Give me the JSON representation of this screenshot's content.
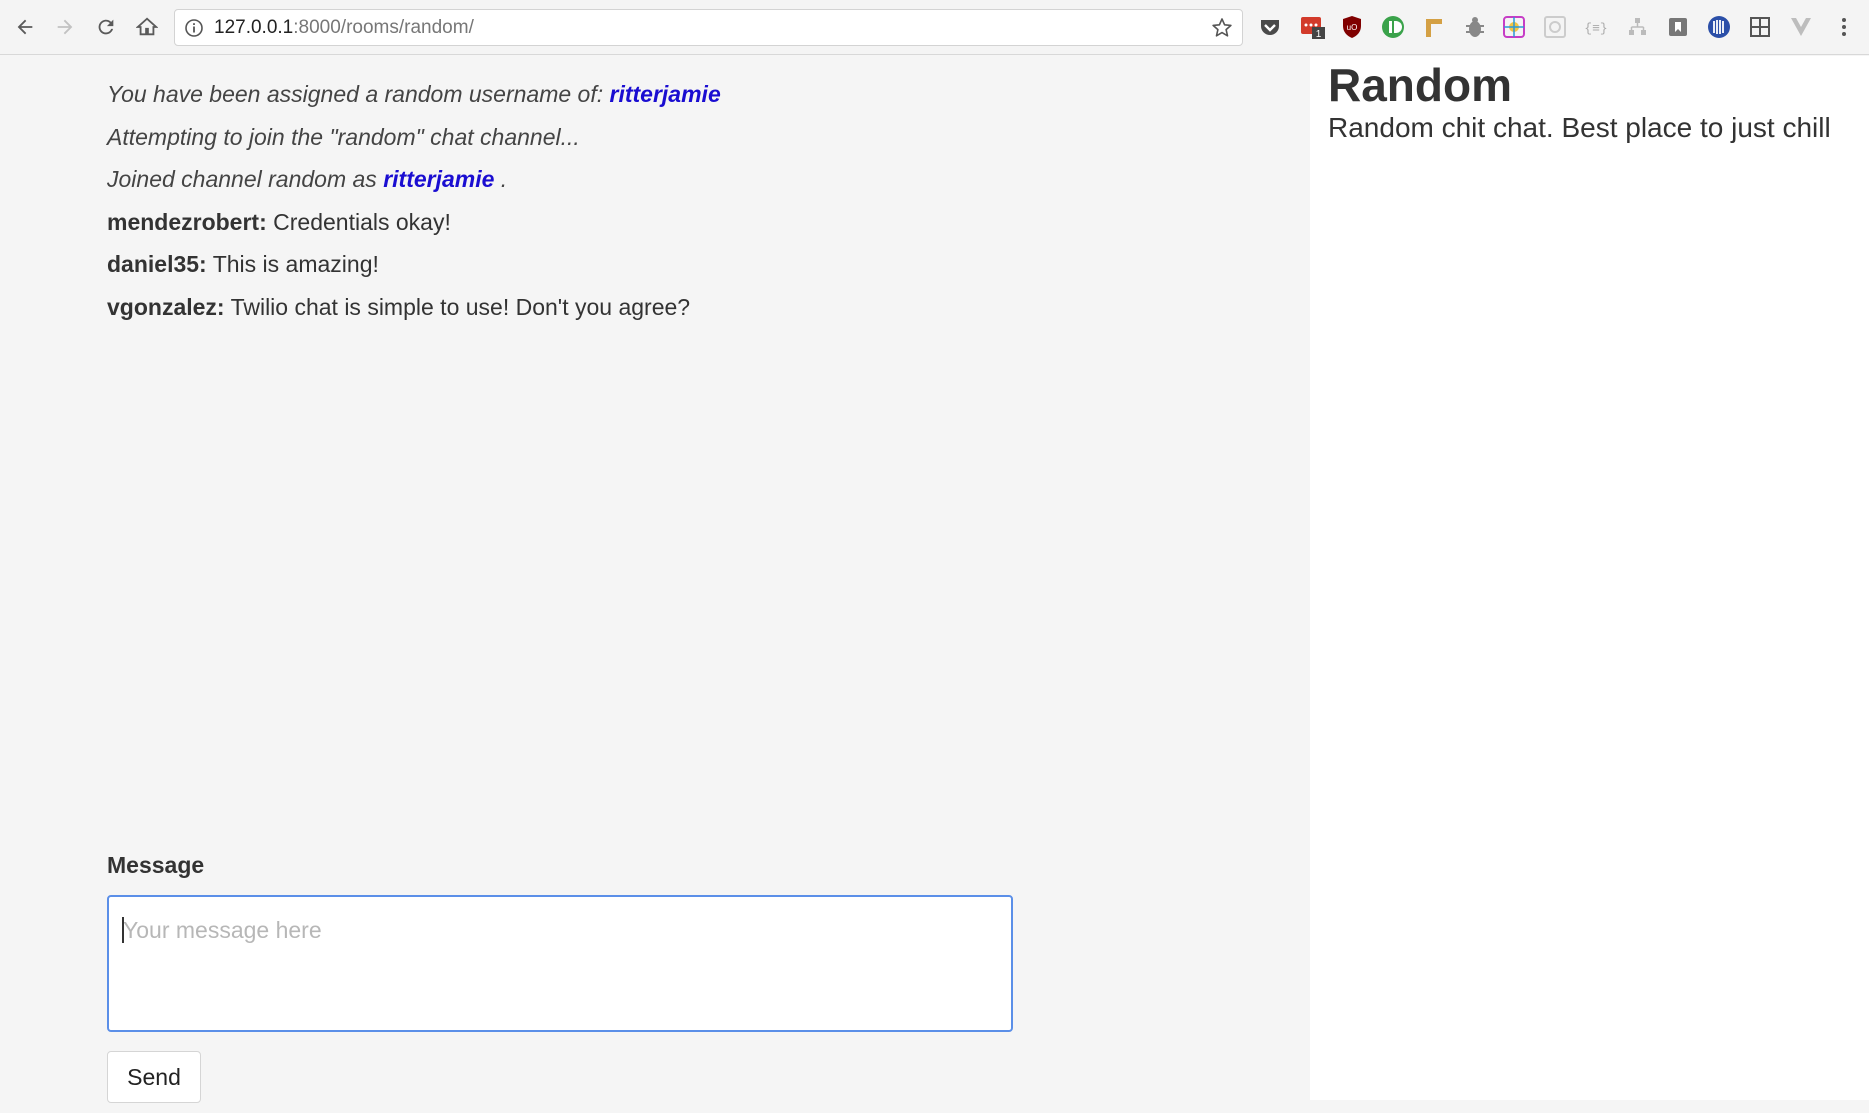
{
  "browser": {
    "url_host": "127.0.0.1",
    "url_rest": ":8000/rooms/random/",
    "nav": [
      "back-arrow-icon",
      "forward-arrow-icon",
      "reload-icon",
      "home-icon"
    ],
    "extensions": [
      {
        "name": "pocket-icon",
        "color": "#4a4a4a"
      },
      {
        "name": "badge-extension-icon",
        "color": "#d23a2a",
        "badge": "1"
      },
      {
        "name": "ublock-icon",
        "color": "#800000"
      },
      {
        "name": "green-circle-extension-icon",
        "color": "#3aa24a"
      },
      {
        "name": "ruler-extension-icon",
        "color": "#d4a044"
      },
      {
        "name": "bug-extension-icon",
        "color": "#888888"
      },
      {
        "name": "color-picker-extension-icon",
        "color": "#c63dc6"
      },
      {
        "name": "grid-extension-icon",
        "color": "#cccccc"
      },
      {
        "name": "json-extension-icon",
        "color": "#aaaaaa"
      },
      {
        "name": "tree-extension-icon",
        "color": "#bbbbbb"
      },
      {
        "name": "bookmark-extension-icon",
        "color": "#777777"
      },
      {
        "name": "blue-circle-extension-icon",
        "color": "#2b4fa8"
      },
      {
        "name": "window-grid-icon",
        "color": "#555555"
      },
      {
        "name": "vue-extension-icon",
        "color": "#bdbdbd"
      }
    ]
  },
  "chat": {
    "messages": [
      {
        "type": "info",
        "text": "You have been assigned a random username of: ",
        "username": "ritterjamie",
        "suffix": ""
      },
      {
        "type": "info",
        "text": "Attempting to join the \"random\" chat channel...",
        "username": "",
        "suffix": ""
      },
      {
        "type": "info",
        "text": "Joined channel random as ",
        "username": "ritterjamie",
        "suffix": " ."
      },
      {
        "type": "chat",
        "author": "mendezrobert:",
        "body": "Credentials okay!"
      },
      {
        "type": "chat",
        "author": "daniel35:",
        "body": "This is amazing!"
      },
      {
        "type": "chat",
        "author": "vgonzalez:",
        "body": "Twilio chat is simple to use! Don't you agree?"
      }
    ],
    "message_label": "Message",
    "message_placeholder": "Your message here",
    "message_value": "",
    "send_label": "Send"
  },
  "room": {
    "title": "Random",
    "description": "Random chit chat. Best place to just chill"
  },
  "colors": {
    "link": "#1a0dd1",
    "input_focus_border": "#5b8fe8"
  }
}
